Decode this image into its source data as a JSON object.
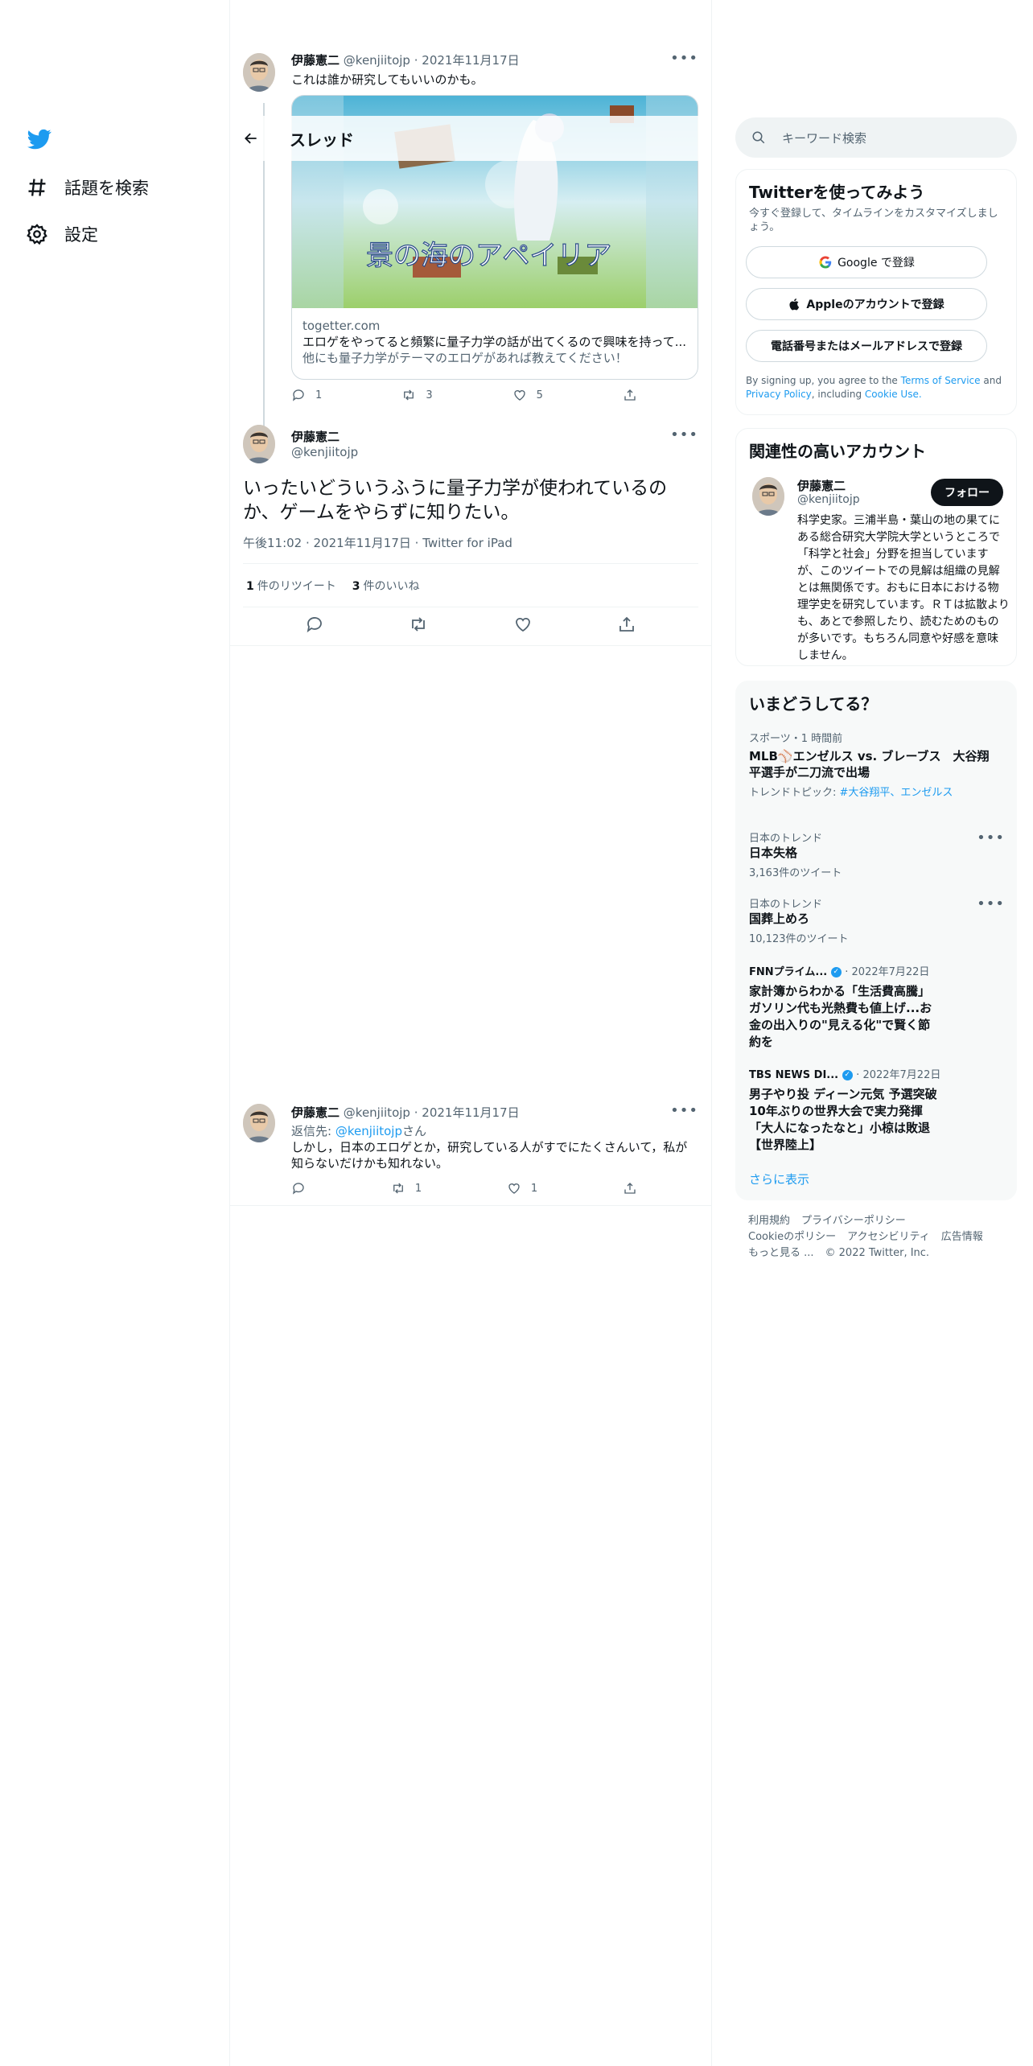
{
  "nav": {
    "explore_label": "話題を検索",
    "settings_label": "設定"
  },
  "header": {
    "title": "スレッド"
  },
  "tweet1": {
    "name": "伊藤憲二",
    "handle": "@kenjiitojp",
    "date": "2021年11月17日",
    "text": "これは誰か研究してもいいのかも。",
    "card": {
      "domain": "togetter.com",
      "title": "エロゲをやってると頻繁に量子力学の話が出てくるので興味を持って...",
      "desc": "他にも量子力学がテーマのエロゲがあれば教えてください！",
      "image_caption": "景の海のアペイリア"
    },
    "replies": "1",
    "retweets": "3",
    "likes": "5"
  },
  "focus": {
    "name": "伊藤憲二",
    "handle": "@kenjiitojp",
    "text": "いったいどういうふうに量子力学が使われているのか、ゲームをやらずに知りたい。",
    "time": "午後11:02",
    "date": "2021年11月17日",
    "client": "Twitter for iPad",
    "retweet_count": "1",
    "retweet_label": "件のリツイート",
    "like_count": "3",
    "like_label": "件のいいね"
  },
  "reply": {
    "name": "伊藤憲二",
    "handle": "@kenjiitojp",
    "date": "2021年11月17日",
    "reply_to_label": "返信先:",
    "reply_to_handle": "@kenjiitojp",
    "reply_to_suffix": "さん",
    "text": "しかし，日本のエロゲとか，研究している人がすでにたくさんいて，私が知らないだけかも知れない。",
    "retweets": "1",
    "likes": "1"
  },
  "search": {
    "placeholder": "キーワード検索"
  },
  "signup": {
    "title": "Twitterを使ってみよう",
    "subtitle": "今すぐ登録して、タイムラインをカスタマイズしましょう。",
    "google": "Google で登録",
    "apple": "Appleのアカウントで登録",
    "phone": "電話番号またはメールアドレスで登録",
    "legal_1": "By signing up, you agree to the",
    "tos": "Terms of Service",
    "and": "and",
    "privacy": "Privacy Policy",
    "including": ", including",
    "cookie": "Cookie Use."
  },
  "relevant": {
    "title": "関連性の高いアカウント",
    "name": "伊藤憲二",
    "handle": "@kenjiitojp",
    "follow": "フォロー",
    "bio": "科学史家。三浦半島・葉山の地の果てにある総合研究大学院大学というところで「科学と社会」分野を担当していますが、このツイートでの見解は組織の見解とは無関係です。おもに日本における物理学史を研究しています。ＲＴは拡散よりも、あとで参照したり、読むためのものが多いです。もちろん同意や好感を意味しません。"
  },
  "trends": {
    "title": "いまどうしてる？",
    "items": [
      {
        "context": "スポーツ・1 時間前",
        "title": "MLB⚾エンゼルス vs. ブレーブス　大谷翔平選手が二刀流で出場",
        "sub_label": "トレンドトピック:",
        "sub_link": "#大谷翔平、エンゼルス"
      },
      {
        "context": "日本のトレンド",
        "title": "日本失格",
        "sub": "3,163件のツイート"
      },
      {
        "context": "日本のトレンド",
        "title": "国葬上めろ",
        "sub": "10,123件のツイート"
      },
      {
        "context": "FNNプライム...",
        "date": "2022年7月22日",
        "title": "家計簿からわかる「生活費高騰」ガソリン代も光熱費も値上げ...お金の出入りの\"見える化\"で賢く節約を"
      },
      {
        "context": "TBS NEWS DI...",
        "date": "2022年7月22日",
        "title": "男子やり投 ディーン元気 予選突破 10年ぶりの世界大会で実力発揮「大人になったなと」小椋は敗退【世界陸上】"
      }
    ],
    "show_more": "さらに表示"
  },
  "footer": {
    "tos": "利用規約",
    "privacy": "プライバシーポリシー",
    "cookie": "Cookieのポリシー",
    "accessibility": "アクセシビリティ",
    "ads": "広告情報",
    "more": "もっと見る ...",
    "copyright": "© 2022 Twitter, Inc."
  }
}
